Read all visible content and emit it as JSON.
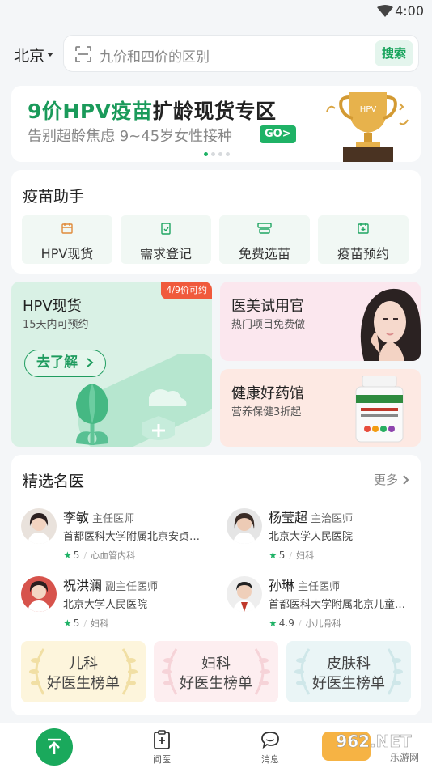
{
  "status_bar": {
    "time": "4:00"
  },
  "header": {
    "city": "北京",
    "search_placeholder": "九价和四价的区别",
    "search_button": "搜索"
  },
  "banner": {
    "title_accent": "9价HPV疫苗",
    "title_rest": "扩龄现货专区",
    "subtitle": "告别超龄焦虑 9~45岁女性接种",
    "go": "GO>",
    "trophy_text": "HPV"
  },
  "vaccine_assistant": {
    "title": "疫苗助手",
    "tools": [
      {
        "label": "HPV现货",
        "icon": "calendar-icon"
      },
      {
        "label": "需求登记",
        "icon": "clipboard-icon"
      },
      {
        "label": "免费选苗",
        "icon": "vaccine-box-icon"
      },
      {
        "label": "疫苗预约",
        "icon": "calendar-plus-icon"
      }
    ]
  },
  "promos": {
    "hpv": {
      "title": "HPV现货",
      "subtitle": "15天内可预约",
      "tag": "4/9价可约",
      "button": "去了解"
    },
    "beauty": {
      "title": "医美试用官",
      "subtitle": "热门项目免费做"
    },
    "health": {
      "title": "健康好药馆",
      "subtitle": "营养保健3折起"
    }
  },
  "doctors": {
    "title": "精选名医",
    "more": "更多",
    "list": [
      {
        "name": "李敏",
        "title": "主任医师",
        "hospital": "首都医科大学附属北京安贞医院",
        "rating": "5",
        "dept": "心血管内科"
      },
      {
        "name": "杨莹超",
        "title": "主治医师",
        "hospital": "北京大学人民医院",
        "rating": "5",
        "dept": "妇科"
      },
      {
        "name": "祝洪澜",
        "title": "副主任医师",
        "hospital": "北京大学人民医院",
        "rating": "5",
        "dept": "妇科"
      },
      {
        "name": "孙琳",
        "title": "主任医师",
        "hospital": "首都医科大学附属北京儿童医院",
        "rating": "4.9",
        "dept": "小儿骨科"
      }
    ],
    "rankings": [
      {
        "dept": "儿科",
        "label": "好医生榜单",
        "color": "#fdf5dc"
      },
      {
        "dept": "妇科",
        "label": "好医生榜单",
        "color": "#fdeef0"
      },
      {
        "dept": "皮肤科",
        "label": "好医生榜单",
        "color": "#eaf5f6"
      }
    ]
  },
  "tabbar": {
    "tabs": [
      {
        "label": "问医",
        "icon": "medical-clipboard-icon"
      },
      {
        "label": "消息",
        "icon": "chat-bubble-icon"
      }
    ]
  },
  "watermark": {
    "text": "962.NET",
    "sub": "乐游网"
  },
  "colors": {
    "brand_green": "#1fb266",
    "tag_red": "#f05a3c"
  }
}
